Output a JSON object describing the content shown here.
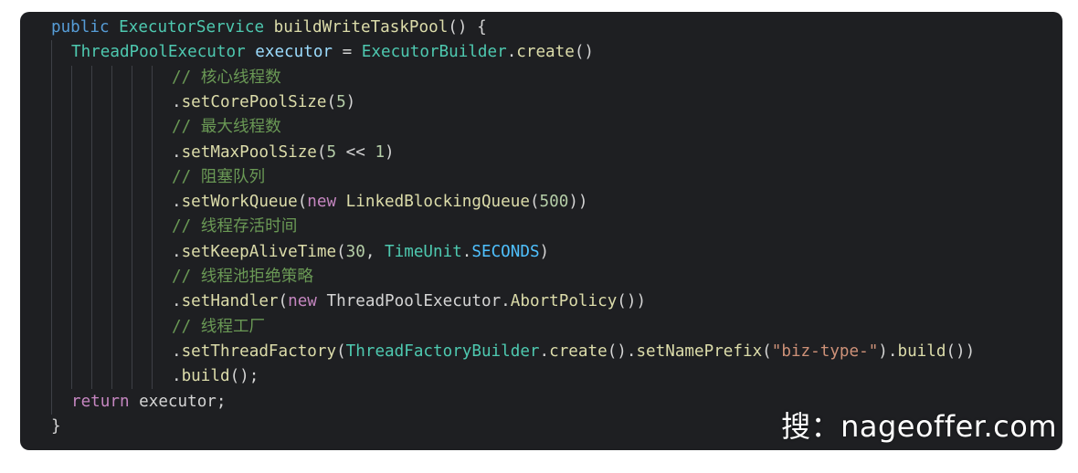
{
  "colors": {
    "background": "#1e1f22",
    "keyword": "#569cd6",
    "type": "#4ec9b0",
    "function": "#dcdcaa",
    "variable": "#9cdcfe",
    "control": "#c586c0",
    "number": "#b5cea8",
    "string": "#ce9178",
    "comment": "#6a9955",
    "plain": "#d4d4d4",
    "constant": "#4fc1ff"
  },
  "code": {
    "lines": [
      {
        "indent": 0,
        "tokens": [
          [
            "kw",
            "public"
          ],
          [
            "pl",
            " "
          ],
          [
            "type",
            "ExecutorService"
          ],
          [
            "pl",
            " "
          ],
          [
            "fn",
            "buildWriteTaskPool"
          ],
          [
            "pl",
            "() {"
          ]
        ]
      },
      {
        "indent": 1,
        "tokens": [
          [
            "type",
            "ThreadPoolExecutor"
          ],
          [
            "pl",
            " "
          ],
          [
            "var",
            "executor"
          ],
          [
            "pl",
            " = "
          ],
          [
            "type",
            "ExecutorBuilder"
          ],
          [
            "pl",
            "."
          ],
          [
            "fn",
            "create"
          ],
          [
            "pl",
            "()"
          ]
        ]
      },
      {
        "indent": 6,
        "tokens": [
          [
            "cm",
            "// 核心线程数"
          ]
        ]
      },
      {
        "indent": 6,
        "tokens": [
          [
            "pl",
            "."
          ],
          [
            "fn",
            "setCorePoolSize"
          ],
          [
            "pl",
            "("
          ],
          [
            "num",
            "5"
          ],
          [
            "pl",
            ")"
          ]
        ]
      },
      {
        "indent": 6,
        "tokens": [
          [
            "cm",
            "// 最大线程数"
          ]
        ]
      },
      {
        "indent": 6,
        "tokens": [
          [
            "pl",
            "."
          ],
          [
            "fn",
            "setMaxPoolSize"
          ],
          [
            "pl",
            "("
          ],
          [
            "num",
            "5"
          ],
          [
            "pl",
            " << "
          ],
          [
            "num",
            "1"
          ],
          [
            "pl",
            ")"
          ]
        ]
      },
      {
        "indent": 6,
        "tokens": [
          [
            "cm",
            "// 阻塞队列"
          ]
        ]
      },
      {
        "indent": 6,
        "tokens": [
          [
            "pl",
            "."
          ],
          [
            "fn",
            "setWorkQueue"
          ],
          [
            "pl",
            "("
          ],
          [
            "ctrl",
            "new"
          ],
          [
            "pl",
            " "
          ],
          [
            "fn",
            "LinkedBlockingQueue"
          ],
          [
            "pl",
            "("
          ],
          [
            "num",
            "500"
          ],
          [
            "pl",
            "))"
          ]
        ]
      },
      {
        "indent": 6,
        "tokens": [
          [
            "cm",
            "// 线程存活时间"
          ]
        ]
      },
      {
        "indent": 6,
        "tokens": [
          [
            "pl",
            "."
          ],
          [
            "fn",
            "setKeepAliveTime"
          ],
          [
            "pl",
            "("
          ],
          [
            "num",
            "30"
          ],
          [
            "pl",
            ", "
          ],
          [
            "type",
            "TimeUnit"
          ],
          [
            "pl",
            "."
          ],
          [
            "const",
            "SECONDS"
          ],
          [
            "pl",
            ")"
          ]
        ]
      },
      {
        "indent": 6,
        "tokens": [
          [
            "cm",
            "// 线程池拒绝策略"
          ]
        ]
      },
      {
        "indent": 6,
        "tokens": [
          [
            "pl",
            "."
          ],
          [
            "fn",
            "setHandler"
          ],
          [
            "pl",
            "("
          ],
          [
            "ctrl",
            "new"
          ],
          [
            "pl",
            " ThreadPoolExecutor."
          ],
          [
            "fn",
            "AbortPolicy"
          ],
          [
            "pl",
            "())"
          ]
        ]
      },
      {
        "indent": 6,
        "tokens": [
          [
            "cm",
            "// 线程工厂"
          ]
        ]
      },
      {
        "indent": 6,
        "tokens": [
          [
            "pl",
            "."
          ],
          [
            "fn",
            "setThreadFactory"
          ],
          [
            "pl",
            "("
          ],
          [
            "type",
            "ThreadFactoryBuilder"
          ],
          [
            "pl",
            "."
          ],
          [
            "fn",
            "create"
          ],
          [
            "pl",
            "()."
          ],
          [
            "fn",
            "setNamePrefix"
          ],
          [
            "pl",
            "("
          ],
          [
            "str",
            "\"biz-type-\""
          ],
          [
            "pl",
            ")."
          ],
          [
            "fn",
            "build"
          ],
          [
            "pl",
            "())"
          ]
        ]
      },
      {
        "indent": 6,
        "tokens": [
          [
            "pl",
            "."
          ],
          [
            "fn",
            "build"
          ],
          [
            "pl",
            "();"
          ]
        ]
      },
      {
        "indent": 1,
        "tokens": [
          [
            "ctrl",
            "return"
          ],
          [
            "pl",
            " executor;"
          ]
        ]
      },
      {
        "indent": 0,
        "tokens": [
          [
            "pl",
            "}"
          ]
        ]
      }
    ]
  },
  "watermark": {
    "text": "搜：nageoffer.com"
  }
}
